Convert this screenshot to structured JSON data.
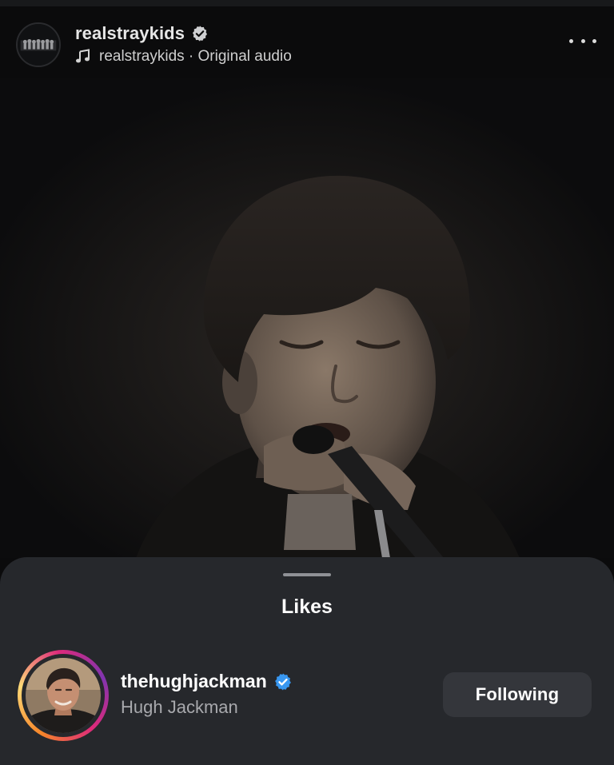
{
  "post": {
    "username": "realstraykids",
    "verified": true,
    "audio_label": "realstraykids · Original audio",
    "avatar": "group-photo",
    "icons": {
      "music": "music-note-icon",
      "more": "more-options-icon",
      "verified": "verified-badge-icon"
    }
  },
  "video": {
    "subject": "performer singing into microphone"
  },
  "likes_sheet": {
    "title": "Likes",
    "items": [
      {
        "username": "thehughjackman",
        "full_name": "Hugh Jackman",
        "verified": true,
        "has_story": true,
        "button_label": "Following"
      }
    ]
  },
  "colors": {
    "background": "#0b0b0c",
    "sheet": "#26282c",
    "button": "#34363b",
    "verified_blue": "#3897f0",
    "secondary_text": "#a8a9ad"
  }
}
